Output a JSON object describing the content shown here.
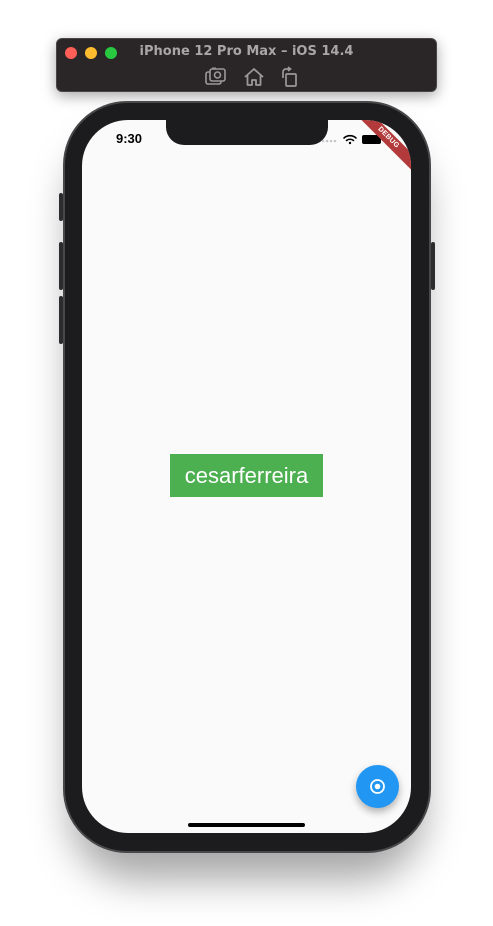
{
  "simulator": {
    "title": "iPhone 12 Pro Max – iOS 14.4",
    "tools": [
      "screenshot-icon",
      "home-icon",
      "rotate-icon"
    ]
  },
  "status_bar": {
    "time": "9:30"
  },
  "debug_banner": {
    "label": "DEBUG"
  },
  "main": {
    "label": "cesarferreira",
    "label_bg": "#4caf50"
  },
  "fab": {
    "icon": "radio-button-icon",
    "color": "#2196f3"
  }
}
